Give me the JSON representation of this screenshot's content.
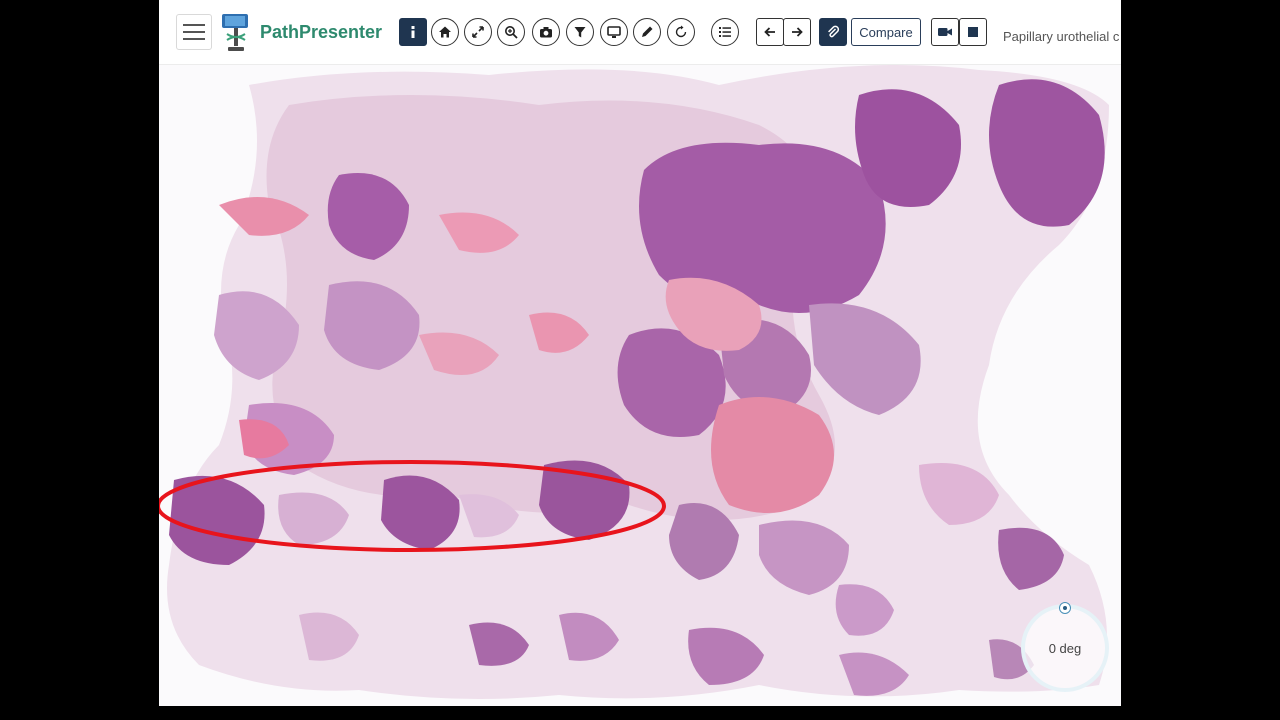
{
  "app": {
    "brand": "PathPresenter",
    "compare_label": "Compare",
    "slide_title": "Papillary urothelial c"
  },
  "toolbar_icons": [
    "menu-icon",
    "info-icon",
    "home-icon",
    "fullscreen-icon",
    "zoom-icon",
    "camera-icon",
    "filter-icon",
    "screen-icon",
    "pencil-icon",
    "rotate-icon",
    "list-icon",
    "arrow-left-icon",
    "arrow-right-icon",
    "paperclip-icon",
    "video-icon",
    "stop-icon"
  ],
  "rotation": {
    "label": "0 deg"
  },
  "colors": {
    "brand": "#2e8a6e",
    "annotation": "#e8141c",
    "tissue_dark": "#9a4f9a",
    "tissue_light": "#e2b9d8",
    "tissue_pink": "#e77a9f"
  }
}
